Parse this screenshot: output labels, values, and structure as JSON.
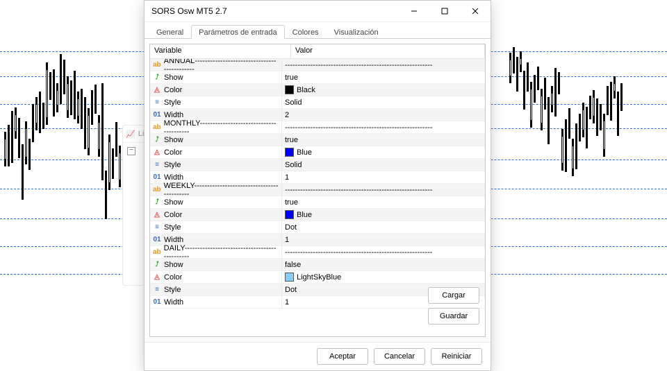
{
  "dialog": {
    "title": "SORS Osw MT5 2.7",
    "tabs": [
      "General",
      "Parámetros de entrada",
      "Colores",
      "Visualización"
    ],
    "active_tab": 1,
    "header": {
      "variable": "Variable",
      "value": "Valor"
    },
    "rows": [
      {
        "kind": "section",
        "label": "ANNUAL",
        "dashes": "--------------------------------------------",
        "vdashes": "----------------------------------------------------------"
      },
      {
        "kind": "show",
        "label": "Show",
        "value": "true"
      },
      {
        "kind": "color",
        "label": "Color",
        "value": "Black",
        "hex": "#000000"
      },
      {
        "kind": "style",
        "label": "Style",
        "value": "Solid"
      },
      {
        "kind": "width",
        "label": "Width",
        "value": "2"
      },
      {
        "kind": "section",
        "label": "MONTHLY",
        "dashes": "----------------------------------------",
        "vdashes": "----------------------------------------------------------"
      },
      {
        "kind": "show",
        "label": "Show",
        "value": "true"
      },
      {
        "kind": "color",
        "label": "Color",
        "value": "Blue",
        "hex": "#0000ff"
      },
      {
        "kind": "style",
        "label": "Style",
        "value": "Solid"
      },
      {
        "kind": "width",
        "label": "Width",
        "value": "1"
      },
      {
        "kind": "section",
        "label": "WEEKLY",
        "dashes": "-------------------------------------------",
        "vdashes": "----------------------------------------------------------"
      },
      {
        "kind": "show",
        "label": "Show",
        "value": "true"
      },
      {
        "kind": "color",
        "label": "Color",
        "value": "Blue",
        "hex": "#0000ff"
      },
      {
        "kind": "style",
        "label": "Style",
        "value": "Dot"
      },
      {
        "kind": "width",
        "label": "Width",
        "value": "1"
      },
      {
        "kind": "section",
        "label": "DAILY",
        "dashes": "----------------------------------------------",
        "vdashes": "----------------------------------------------------------"
      },
      {
        "kind": "show",
        "label": "Show",
        "value": "false"
      },
      {
        "kind": "color",
        "label": "Color",
        "value": "LightSkyBlue",
        "hex": "#87cefa"
      },
      {
        "kind": "style",
        "label": "Style",
        "value": "Dot"
      },
      {
        "kind": "width",
        "label": "Width",
        "value": "1"
      }
    ],
    "side_buttons": {
      "load": "Cargar",
      "save": "Guardar"
    },
    "footer": {
      "accept": "Aceptar",
      "cancel": "Cancelar",
      "reset": "Reiniciar"
    }
  },
  "small_panel": {
    "header": "Li"
  },
  "hlines_y": [
    74,
    110,
    150,
    185,
    230,
    272,
    315,
    355,
    395
  ],
  "candles_left": [
    [
      6,
      130,
      30,
      146,
      12
    ],
    [
      11,
      120,
      40,
      130,
      20
    ],
    [
      16,
      100,
      55,
      118,
      22
    ],
    [
      21,
      95,
      25,
      102,
      15
    ],
    [
      26,
      110,
      38,
      120,
      14
    ],
    [
      31,
      148,
      60,
      160,
      20
    ],
    [
      36,
      115,
      42,
      124,
      18
    ],
    [
      41,
      140,
      25,
      150,
      12
    ],
    [
      46,
      90,
      35,
      98,
      16
    ],
    [
      51,
      80,
      28,
      90,
      18
    ],
    [
      56,
      72,
      40,
      80,
      12
    ],
    [
      61,
      88,
      18,
      96,
      10
    ],
    [
      66,
      30,
      70,
      36,
      50
    ],
    [
      71,
      44,
      20,
      52,
      12
    ],
    [
      76,
      40,
      48,
      48,
      30
    ],
    [
      81,
      60,
      22,
      68,
      12
    ],
    [
      86,
      18,
      52,
      26,
      38
    ],
    [
      91,
      26,
      30,
      34,
      20
    ],
    [
      96,
      50,
      40,
      58,
      26
    ],
    [
      101,
      56,
      30,
      64,
      18
    ],
    [
      106,
      42,
      50,
      50,
      32
    ],
    [
      111,
      72,
      26,
      80,
      14
    ],
    [
      116,
      68,
      38,
      76,
      22
    ],
    [
      121,
      80,
      55,
      90,
      30
    ],
    [
      126,
      96,
      48,
      106,
      28
    ],
    [
      131,
      70,
      30,
      80,
      18
    ],
    [
      136,
      62,
      22,
      70,
      14
    ],
    [
      141,
      106,
      40,
      116,
      22
    ],
    [
      146,
      60,
      120,
      70,
      90
    ],
    [
      151,
      186,
      50,
      200,
      26
    ],
    [
      156,
      134,
      60,
      146,
      36
    ],
    [
      161,
      154,
      24,
      164,
      12
    ],
    [
      166,
      116,
      30,
      126,
      18
    ],
    [
      171,
      150,
      40,
      160,
      22
    ]
  ],
  "candles_right": [
    [
      8,
      16,
      24,
      24,
      14
    ],
    [
      13,
      8,
      18,
      16,
      10
    ],
    [
      18,
      22,
      30,
      30,
      16
    ],
    [
      23,
      14,
      10,
      22,
      6
    ],
    [
      28,
      42,
      36,
      52,
      20
    ],
    [
      33,
      30,
      22,
      38,
      12
    ],
    [
      38,
      58,
      46,
      70,
      28
    ],
    [
      43,
      48,
      20,
      58,
      12
    ],
    [
      48,
      36,
      14,
      44,
      8
    ],
    [
      53,
      68,
      40,
      78,
      22
    ],
    [
      58,
      52,
      26,
      62,
      14
    ],
    [
      63,
      80,
      48,
      92,
      30
    ],
    [
      68,
      64,
      18,
      72,
      10
    ],
    [
      73,
      38,
      50,
      48,
      32
    ],
    [
      78,
      44,
      12,
      52,
      8
    ],
    [
      83,
      126,
      40,
      136,
      22
    ],
    [
      88,
      112,
      56,
      124,
      34
    ],
    [
      93,
      96,
      24,
      106,
      14
    ],
    [
      98,
      140,
      34,
      150,
      20
    ],
    [
      103,
      118,
      46,
      130,
      28
    ],
    [
      108,
      104,
      20,
      114,
      12
    ],
    [
      113,
      88,
      30,
      98,
      18
    ],
    [
      118,
      94,
      40,
      104,
      22
    ],
    [
      123,
      78,
      14,
      88,
      10
    ],
    [
      128,
      70,
      28,
      80,
      16
    ],
    [
      133,
      82,
      34,
      92,
      20
    ],
    [
      138,
      90,
      18,
      100,
      10
    ],
    [
      143,
      104,
      42,
      114,
      24
    ],
    [
      148,
      64,
      22,
      74,
      12
    ],
    [
      153,
      58,
      36,
      68,
      20
    ],
    [
      158,
      50,
      12,
      60,
      8
    ],
    [
      163,
      72,
      44,
      82,
      26
    ],
    [
      168,
      60,
      20,
      70,
      12
    ]
  ]
}
